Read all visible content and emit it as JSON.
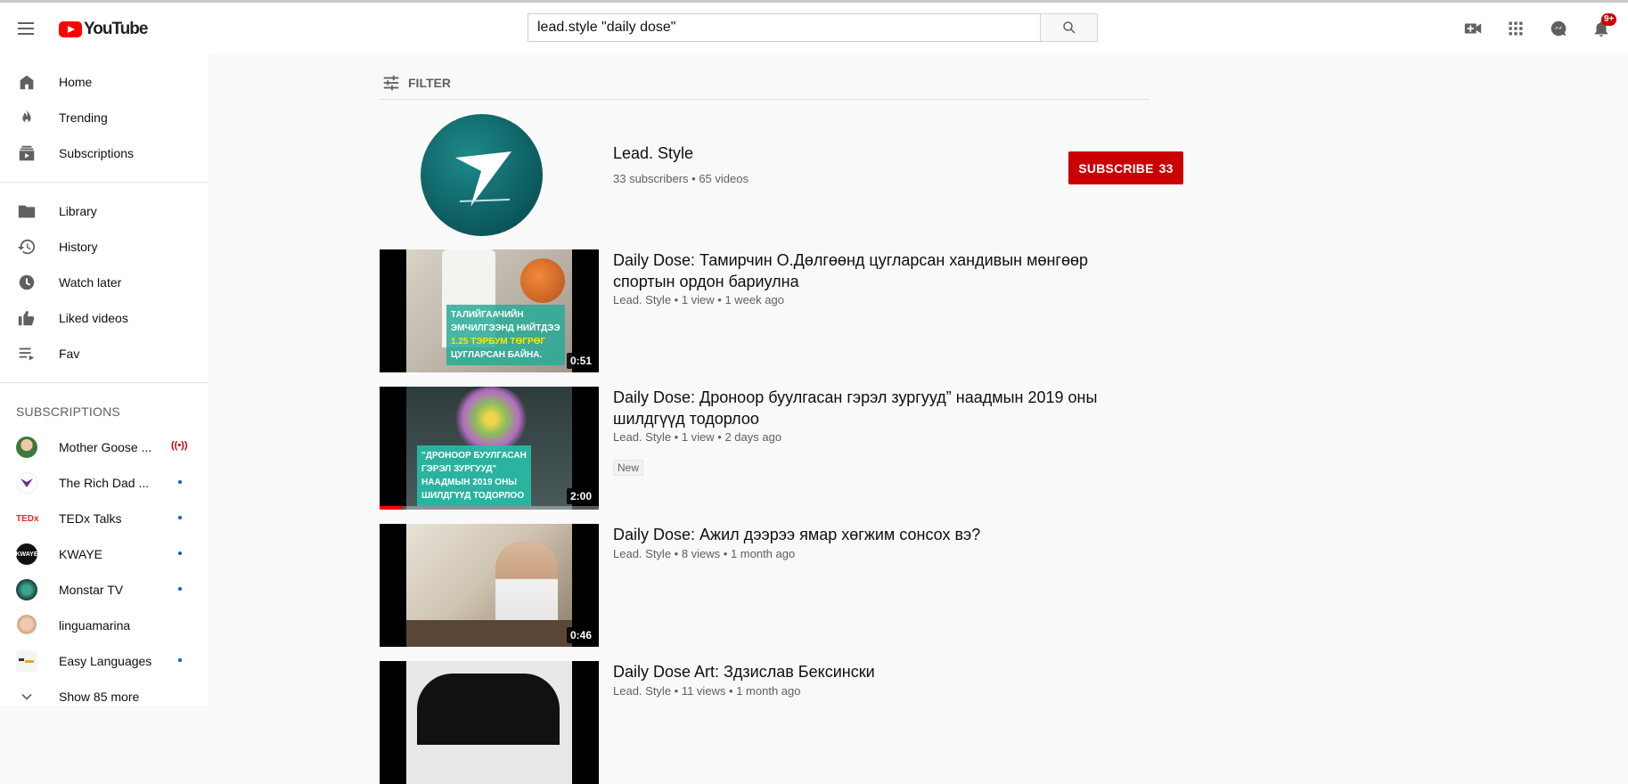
{
  "header": {
    "logo_text": "YouTube",
    "search_value": "lead.style \"daily dose\"",
    "notifications_badge": "9+"
  },
  "sidebar": {
    "items": [
      {
        "label": "Home",
        "icon": "home-icon"
      },
      {
        "label": "Trending",
        "icon": "fire-icon"
      },
      {
        "label": "Subscriptions",
        "icon": "subscriptions-icon"
      }
    ],
    "items2": [
      {
        "label": "Library",
        "icon": "folder-icon"
      },
      {
        "label": "History",
        "icon": "history-icon"
      },
      {
        "label": "Watch later",
        "icon": "clock-icon"
      },
      {
        "label": "Liked videos",
        "icon": "thumbs-up-icon"
      },
      {
        "label": "Fav",
        "icon": "playlist-icon"
      }
    ],
    "subscriptions_heading": "SUBSCRIPTIONS",
    "subscriptions": [
      {
        "name": "Mother Goose ...",
        "status": "live"
      },
      {
        "name": "The Rich Dad ...",
        "status": "new"
      },
      {
        "name": "TEDx Talks",
        "status": "new"
      },
      {
        "name": "KWAYE",
        "status": "new"
      },
      {
        "name": "Monstar TV",
        "status": "new"
      },
      {
        "name": "linguamarina",
        "status": "none"
      },
      {
        "name": "Easy Languages",
        "status": "new"
      }
    ],
    "show_more": "Show 85 more"
  },
  "main": {
    "filter_label": "FILTER",
    "channel": {
      "name": "Lead. Style",
      "meta": "33 subscribers • 65 videos",
      "subscribe_label": "SUBSCRIBE",
      "subscribe_count": "33"
    },
    "videos": [
      {
        "title": "Daily Dose: Тамирчин О.Дөлгөөнд цугларсан хандивын мөнгөөр спортын ордон бариулна",
        "meta": "Lead. Style • 1 view • 1 week ago",
        "duration": "0:51",
        "caption": [
          "ТАЛИЙГААЧИЙН",
          "ЭМЧИЛГЭЭНД НИЙТДЭЭ",
          "1.25 ТЭРБУМ ТӨГРӨГ",
          "ЦУГЛАРСАН БАЙНА."
        ]
      },
      {
        "title": "Daily Dose: Дроноор буулгасан гэрэл зургууд” наадмын 2019 оны шилдгүүд тодорлоо",
        "meta": "Lead. Style • 1 view • 2 days ago",
        "duration": "2:00",
        "badge": "New",
        "watched_fraction": 0.1,
        "caption": [
          "\"ДРОНООР БУУЛГАСАН",
          "ГЭРЭЛ ЗУРГУУД\"",
          "НААДМЫН 2019 ОНЫ",
          "ШИЛДГҮҮД ТОДОРЛОО"
        ]
      },
      {
        "title": "Daily Dose: Ажил дээрээ ямар хөгжим сонсох вэ?",
        "meta": "Lead. Style • 8 views • 1 month ago",
        "duration": "0:46"
      },
      {
        "title": "Daily Dose Art: Здзислав Бексински",
        "meta": "Lead. Style • 11 views • 1 month ago"
      }
    ]
  }
}
